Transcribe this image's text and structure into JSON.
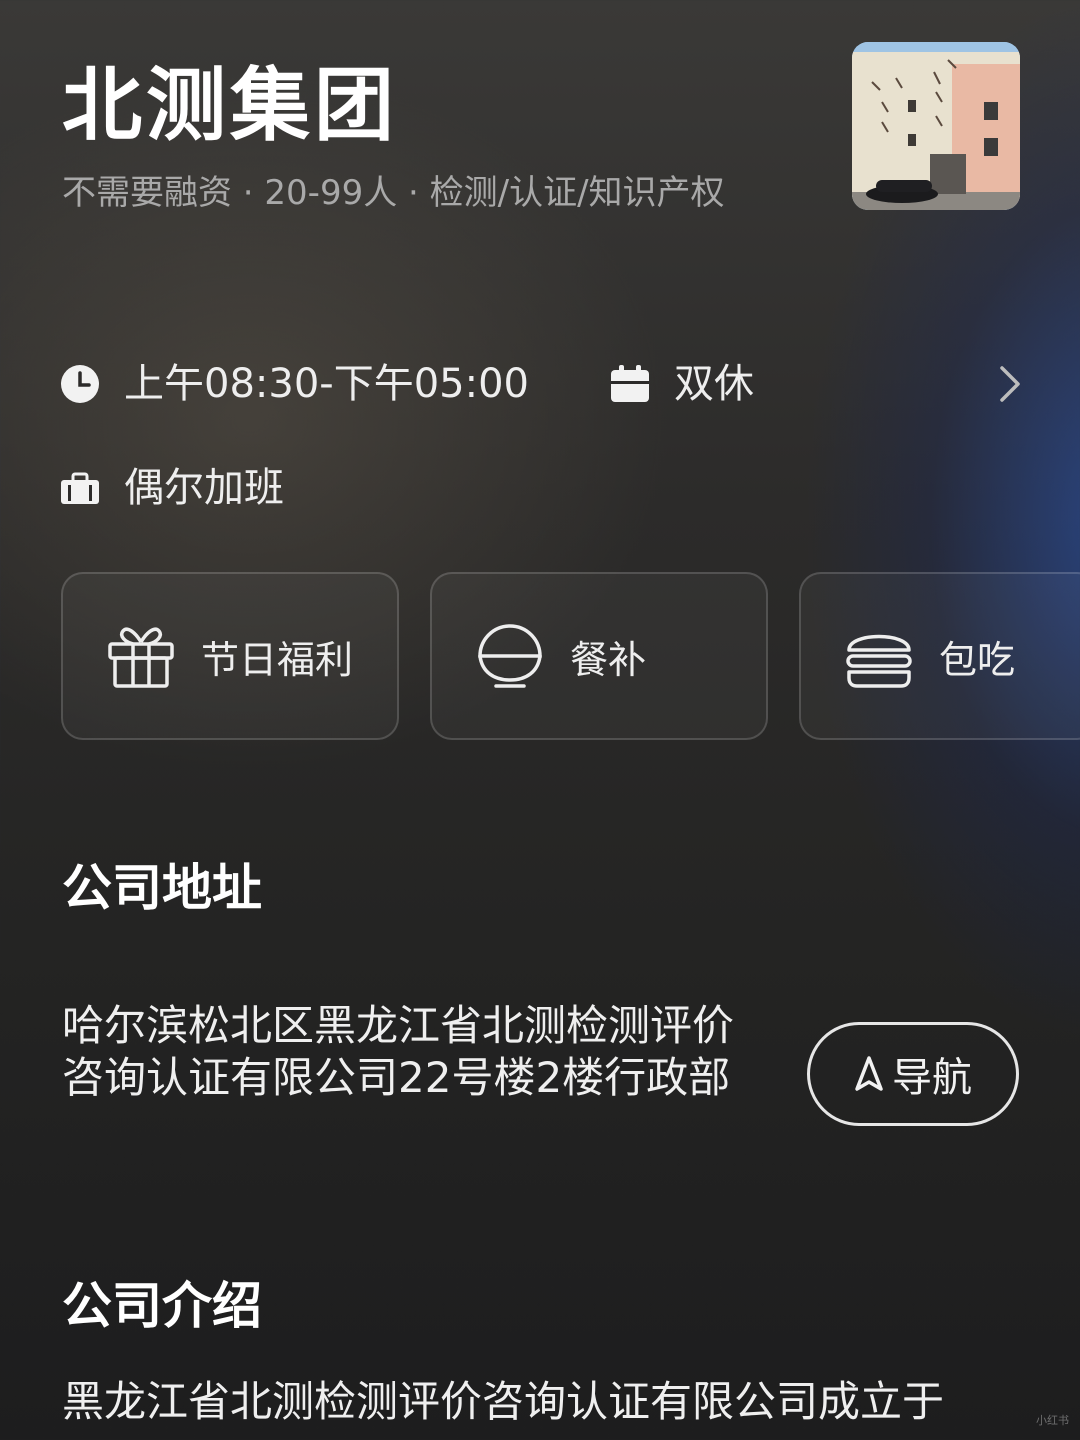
{
  "company": {
    "name": "北测集团",
    "meta": "不需要融资 · 20-99人 · 检测/认证/知识产权"
  },
  "work": {
    "hours": "上午08:30-下午05:00",
    "schedule": "双休",
    "overtime": "偶尔加班"
  },
  "benefits": [
    {
      "label": "节日福利",
      "icon": "gift-icon"
    },
    {
      "label": "餐补",
      "icon": "rice-bowl-icon"
    },
    {
      "label": "包吃",
      "icon": "burger-icon"
    }
  ],
  "address": {
    "title": "公司地址",
    "text": "哈尔滨松北区黑龙江省北测检测评价咨询认证有限公司22号楼2楼行政部",
    "nav_label": "导航"
  },
  "intro": {
    "title": "公司介绍",
    "text": "黑龙江省北测检测评价咨询认证有限公司成立于"
  },
  "watermark": "小红书"
}
